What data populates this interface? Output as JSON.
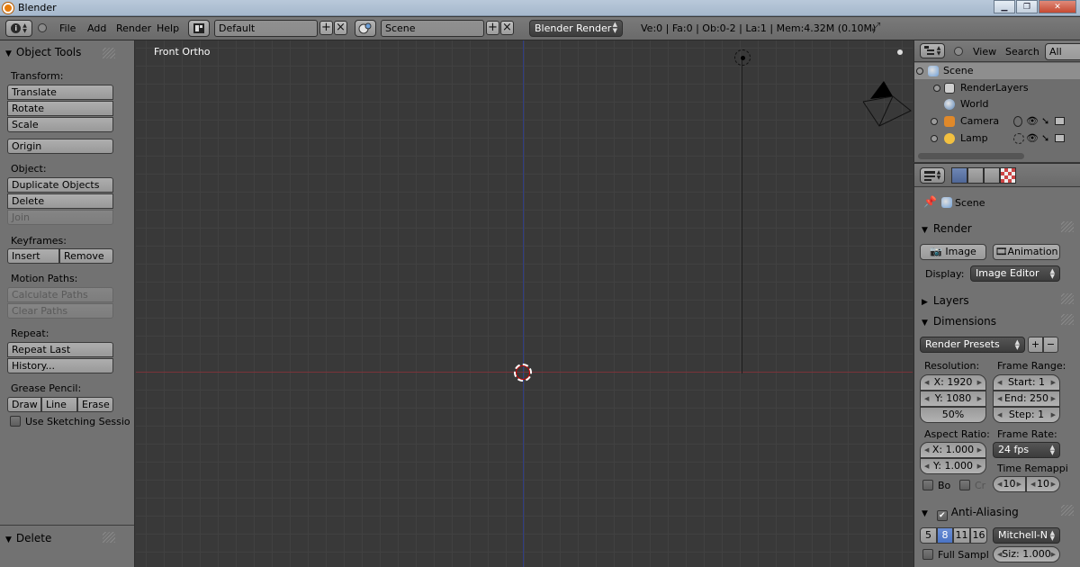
{
  "window": {
    "title": "Blender",
    "min": "0",
    "max": "1",
    "close": "r"
  },
  "header": {
    "menus": [
      "File",
      "Add",
      "Render",
      "Help"
    ],
    "layout": "Default",
    "scene": "Scene",
    "engine": "Blender Render",
    "stats": "Ve:0 | Fa:0 | Ob:0-2 | La:1 | Mem:4.32M (0.10M)"
  },
  "toolshelf": {
    "title": "Object Tools",
    "transform_label": "Transform:",
    "translate": "Translate",
    "rotate": "Rotate",
    "scale": "Scale",
    "origin": "Origin",
    "object_label": "Object:",
    "duplicate": "Duplicate Objects",
    "delete": "Delete",
    "join": "Join",
    "keyframes_label": "Keyframes:",
    "insert": "Insert",
    "remove": "Remove",
    "motion_label": "Motion Paths:",
    "calc_paths": "Calculate Paths",
    "clear_paths": "Clear Paths",
    "repeat_label": "Repeat:",
    "repeat_last": "Repeat Last",
    "history": "History...",
    "grease_label": "Grease Pencil:",
    "draw": "Draw",
    "line": "Line",
    "erase": "Erase",
    "sketching": "Use Sketching Sessio",
    "operator_title": "Delete"
  },
  "viewport": {
    "label": "Front Ortho"
  },
  "outliner": {
    "view": "View",
    "search": "Search",
    "filter": "All Scen",
    "items": {
      "scene": "Scene",
      "renderlayers": "RenderLayers",
      "world": "World",
      "camera": "Camera",
      "lamp": "Lamp"
    }
  },
  "properties": {
    "context": "Scene",
    "render": {
      "title": "Render",
      "image": "Image",
      "animation": "Animation",
      "display_label": "Display:",
      "display_value": "Image Editor"
    },
    "layers": {
      "title": "Layers"
    },
    "dimensions": {
      "title": "Dimensions",
      "presets": "Render Presets",
      "resolution_label": "Resolution:",
      "res_x": "X: 1920",
      "res_y": "Y: 1080",
      "res_pct": "50%",
      "frame_range_label": "Frame Range:",
      "start": "Start: 1",
      "end": "End: 250",
      "step": "Step: 1",
      "aspect_label": "Aspect Ratio:",
      "aspect_x": "X: 1.000",
      "aspect_y": "Y: 1.000",
      "frame_rate_label": "Frame Rate:",
      "fps": "24 fps",
      "time_remap_label": "Time Remappi",
      "remap_old": "10",
      "remap_new": "10",
      "border": "Bo",
      "crop": "Cr"
    },
    "aa": {
      "title": "Anti-Aliasing",
      "samples": [
        "5",
        "8",
        "11",
        "16"
      ],
      "filter": "Mitchell-N",
      "full_sample": "Full Sampl",
      "size": "Siz: 1.000"
    }
  }
}
